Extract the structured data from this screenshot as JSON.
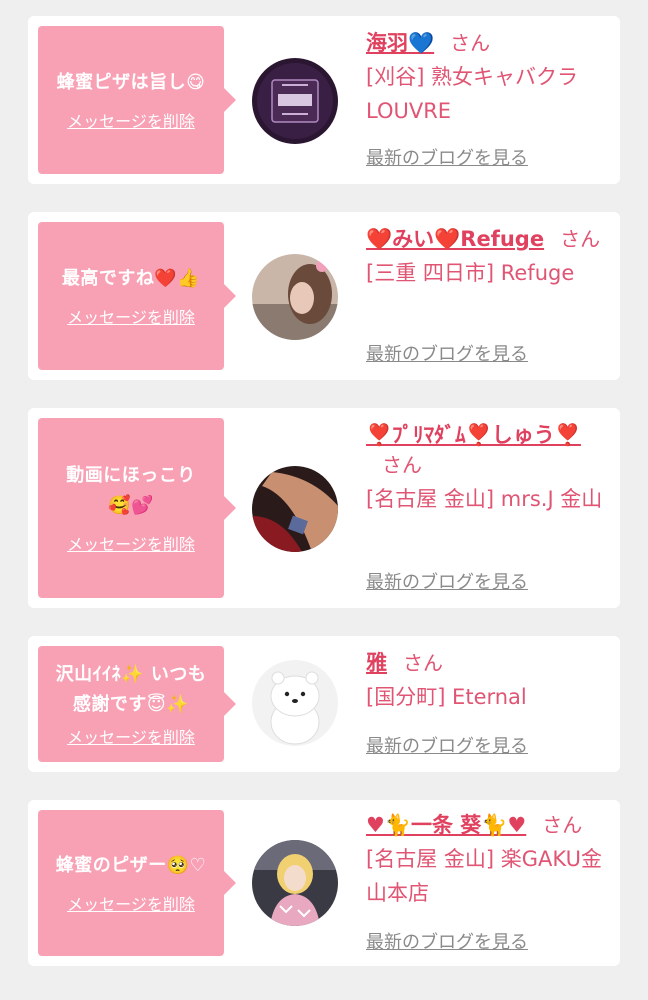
{
  "delete_label": "メッセージを削除",
  "blog_label": "最新のブログを見る",
  "san_label": "さん",
  "colors": {
    "accent": "#e0415f",
    "bubble": "#f8a1b5",
    "link_gray": "#8a8a8a",
    "page_bg": "#efefef"
  },
  "items": [
    {
      "message": "蜂蜜ピザは旨し😋",
      "name": "海羽💙",
      "shop": "[刈谷] 熟女キャバクラLOUVRE",
      "avatar_icon": "louvre-logo-avatar"
    },
    {
      "message": "最高ですね❤️👍",
      "name": "❤️みい❤️Refuge",
      "shop": "[三重 四日市] Refuge",
      "avatar_icon": "woman-photo-avatar"
    },
    {
      "message": "動画にほっこり🥰💕",
      "name": "❣️ﾌﾟﾘﾏﾀﾞﾑ❣️しゅう❣️",
      "shop": "[名古屋 金山] mrs.J 金山",
      "avatar_icon": "legs-photo-avatar"
    },
    {
      "message": "沢山ｲｲﾈ✨ いつも感謝です😇✨",
      "name": "雅",
      "shop": "[国分町] Eternal",
      "avatar_icon": "white-bear-avatar"
    },
    {
      "message": "蜂蜜のピザー🥺♡",
      "name": "♥🐈一条 葵🐈♥",
      "shop": "[名古屋 金山] 楽GAKU金山本店",
      "avatar_icon": "girl-photo-avatar"
    }
  ]
}
